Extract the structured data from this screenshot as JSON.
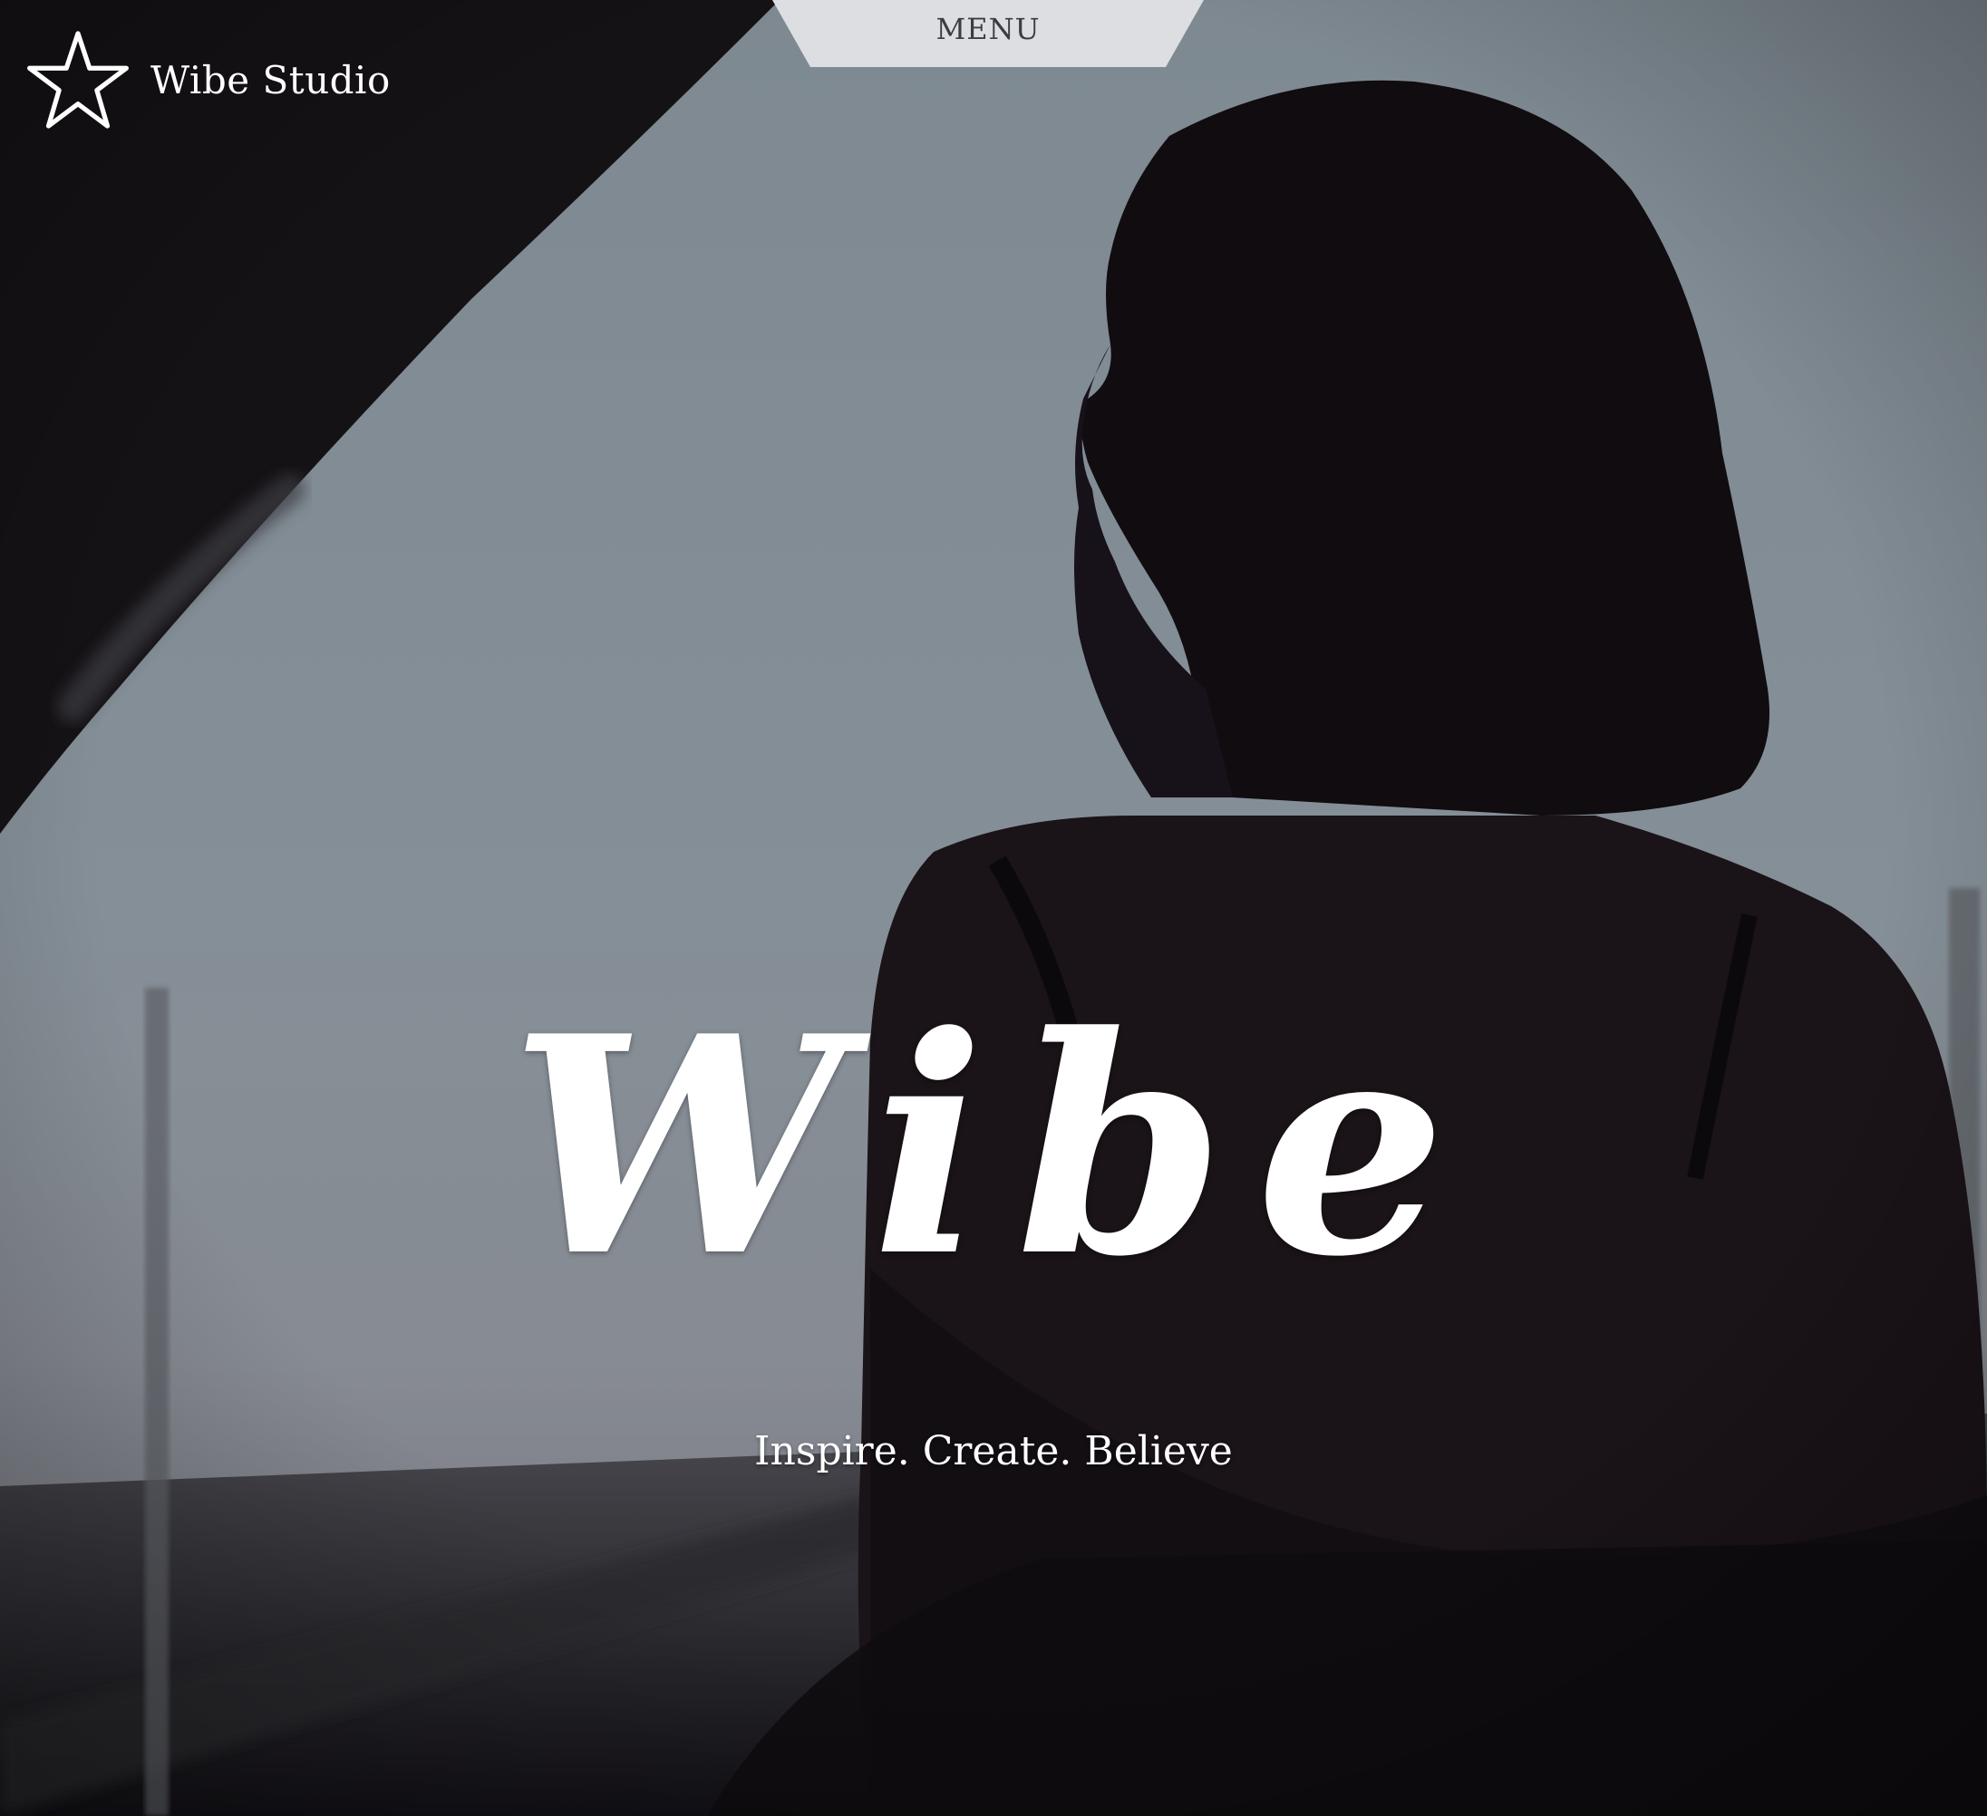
{
  "header": {
    "logo_icon": "star-outline-icon",
    "brand_name": "Wibe Studio",
    "menu_label": "MENU"
  },
  "hero": {
    "background": "silhouette-photo",
    "title": "Wibe",
    "tagline": "Inspire. Create. Believe"
  },
  "colors": {
    "text": "#ffffff",
    "menu_tab_bg": "#dcdee1",
    "menu_text": "#3a3d42",
    "sky": "#848e96",
    "silhouette": "#120e12"
  }
}
